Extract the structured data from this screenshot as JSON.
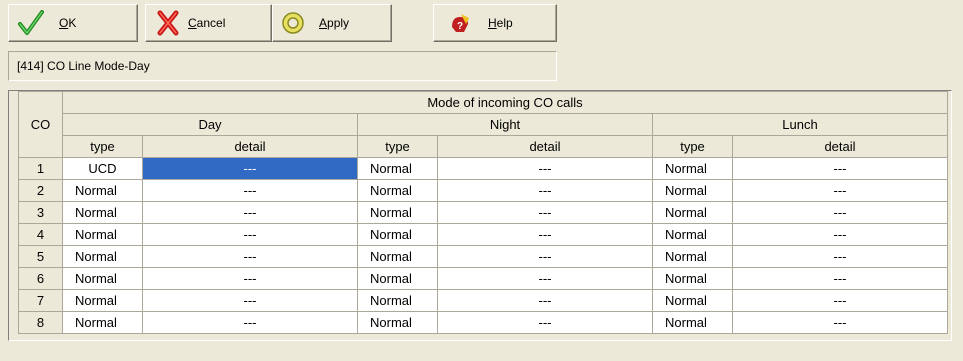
{
  "toolbar": {
    "ok_label_u": "O",
    "ok_label_rest": "K",
    "cancel_label_u": "C",
    "cancel_label_rest": "ancel",
    "apply_label_u": "A",
    "apply_label_rest": "pply",
    "help_label_u": "H",
    "help_label_rest": "elp"
  },
  "title": "[414] CO Line Mode-Day",
  "table": {
    "co_header": "CO",
    "group_header": "Mode of incoming CO calls",
    "sections": [
      "Day",
      "Night",
      "Lunch"
    ],
    "sub_type": "type",
    "sub_detail": "detail",
    "rows": [
      {
        "co": "1",
        "day_type": "UCD",
        "day_detail": "---",
        "night_type": "Normal",
        "night_detail": "---",
        "lunch_type": "Normal",
        "lunch_detail": "---"
      },
      {
        "co": "2",
        "day_type": "Normal",
        "day_detail": "---",
        "night_type": "Normal",
        "night_detail": "---",
        "lunch_type": "Normal",
        "lunch_detail": "---"
      },
      {
        "co": "3",
        "day_type": "Normal",
        "day_detail": "---",
        "night_type": "Normal",
        "night_detail": "---",
        "lunch_type": "Normal",
        "lunch_detail": "---"
      },
      {
        "co": "4",
        "day_type": "Normal",
        "day_detail": "---",
        "night_type": "Normal",
        "night_detail": "---",
        "lunch_type": "Normal",
        "lunch_detail": "---"
      },
      {
        "co": "5",
        "day_type": "Normal",
        "day_detail": "---",
        "night_type": "Normal",
        "night_detail": "---",
        "lunch_type": "Normal",
        "lunch_detail": "---"
      },
      {
        "co": "6",
        "day_type": "Normal",
        "day_detail": "---",
        "night_type": "Normal",
        "night_detail": "---",
        "lunch_type": "Normal",
        "lunch_detail": "---"
      },
      {
        "co": "7",
        "day_type": "Normal",
        "day_detail": "---",
        "night_type": "Normal",
        "night_detail": "---",
        "lunch_type": "Normal",
        "lunch_detail": "---"
      },
      {
        "co": "8",
        "day_type": "Normal",
        "day_detail": "---",
        "night_type": "Normal",
        "night_detail": "---",
        "lunch_type": "Normal",
        "lunch_detail": "---"
      }
    ],
    "selected": {
      "row": 1,
      "column": "day_detail"
    }
  },
  "colors": {
    "background": "#ece9d8",
    "selection": "#316ac5",
    "cell_background": "#ffffff"
  },
  "icons": {
    "ok": "checkmark-icon",
    "cancel": "cross-icon",
    "apply": "ring-icon",
    "help": "help-icon"
  }
}
